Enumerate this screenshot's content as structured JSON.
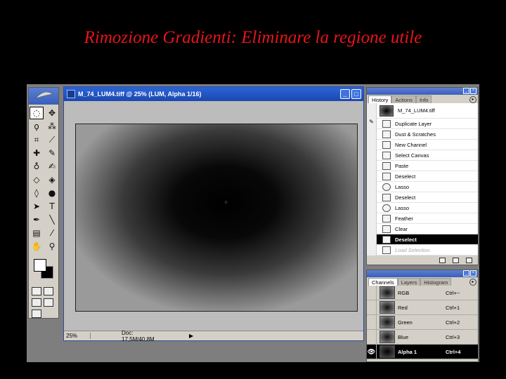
{
  "slide": {
    "title": "Rimozione Gradienti: Eliminare la regione utile"
  },
  "toolbox": {
    "tools": [
      {
        "name": "marquee-tool",
        "glyph": "◌",
        "active": true
      },
      {
        "name": "move-tool",
        "glyph": "✥",
        "active": false
      },
      {
        "name": "lasso-tool",
        "glyph": "ϙ",
        "active": false
      },
      {
        "name": "magic-wand-tool",
        "glyph": "⁂",
        "active": false
      },
      {
        "name": "crop-tool",
        "glyph": "⌗",
        "active": false
      },
      {
        "name": "slice-tool",
        "glyph": "⟋",
        "active": false
      },
      {
        "name": "healing-tool",
        "glyph": "✚",
        "active": false
      },
      {
        "name": "brush-tool",
        "glyph": "✎",
        "active": false
      },
      {
        "name": "stamp-tool",
        "glyph": "♁",
        "active": false
      },
      {
        "name": "history-brush-tool",
        "glyph": "✍",
        "active": false
      },
      {
        "name": "eraser-tool",
        "glyph": "◇",
        "active": false
      },
      {
        "name": "bucket-tool",
        "glyph": "◈",
        "active": false
      },
      {
        "name": "blur-tool",
        "glyph": "◊",
        "active": false
      },
      {
        "name": "dodge-tool",
        "glyph": "●",
        "active": false
      },
      {
        "name": "path-select-tool",
        "glyph": "➤",
        "active": false
      },
      {
        "name": "type-tool",
        "glyph": "T",
        "active": false
      },
      {
        "name": "pen-tool",
        "glyph": "✒",
        "active": false
      },
      {
        "name": "line-tool",
        "glyph": "╲",
        "active": false
      },
      {
        "name": "notes-tool",
        "glyph": "▤",
        "active": false
      },
      {
        "name": "eyedropper-tool",
        "glyph": "⁄",
        "active": false
      },
      {
        "name": "hand-tool",
        "glyph": "✋",
        "active": false
      },
      {
        "name": "zoom-tool",
        "glyph": "⚲",
        "active": false
      }
    ]
  },
  "document": {
    "title": "M_74_LUM4.tiff @ 25% (LUM, Alpha 1/16)",
    "zoom": "25%",
    "doc_info": "Doc: 17,5M/40,8M"
  },
  "history_panel": {
    "tabs": [
      {
        "label": "History",
        "active": true
      },
      {
        "label": "Actions",
        "active": false
      },
      {
        "label": "Info",
        "active": false
      }
    ],
    "snapshot": "M_74_LUM4.tiff",
    "items": [
      {
        "label": "Duplicate Layer",
        "icon": "step",
        "state": "normal",
        "brush": true
      },
      {
        "label": "Dust & Scratches",
        "icon": "step",
        "state": "normal",
        "brush": false
      },
      {
        "label": "New Channel",
        "icon": "step",
        "state": "normal",
        "brush": false
      },
      {
        "label": "Select Canvas",
        "icon": "step",
        "state": "normal",
        "brush": false
      },
      {
        "label": "Paste",
        "icon": "step",
        "state": "normal",
        "brush": false
      },
      {
        "label": "Deselect",
        "icon": "step",
        "state": "normal",
        "brush": false
      },
      {
        "label": "Lasso",
        "icon": "lasso",
        "state": "normal",
        "brush": false
      },
      {
        "label": "Deselect",
        "icon": "step",
        "state": "normal",
        "brush": false
      },
      {
        "label": "Lasso",
        "icon": "lasso",
        "state": "normal",
        "brush": false
      },
      {
        "label": "Feather",
        "icon": "step",
        "state": "normal",
        "brush": false
      },
      {
        "label": "Clear",
        "icon": "step",
        "state": "normal",
        "brush": false
      },
      {
        "label": "Deselect",
        "icon": "step",
        "state": "selected",
        "brush": false
      },
      {
        "label": "Load Selection",
        "icon": "step",
        "state": "future",
        "brush": false
      }
    ]
  },
  "channels_panel": {
    "tabs": [
      {
        "label": "Channels",
        "active": true
      },
      {
        "label": "Layers",
        "active": false
      },
      {
        "label": "Histogram",
        "active": false
      }
    ],
    "channels": [
      {
        "name": "RGB",
        "shortcut": "Ctrl+~",
        "selected": false,
        "visible": false
      },
      {
        "name": "Red",
        "shortcut": "Ctrl+1",
        "selected": false,
        "visible": false
      },
      {
        "name": "Green",
        "shortcut": "Ctrl+2",
        "selected": false,
        "visible": false
      },
      {
        "name": "Blue",
        "shortcut": "Ctrl+3",
        "selected": false,
        "visible": false
      },
      {
        "name": "Alpha 1",
        "shortcut": "Ctrl+4",
        "selected": true,
        "visible": true
      }
    ]
  }
}
